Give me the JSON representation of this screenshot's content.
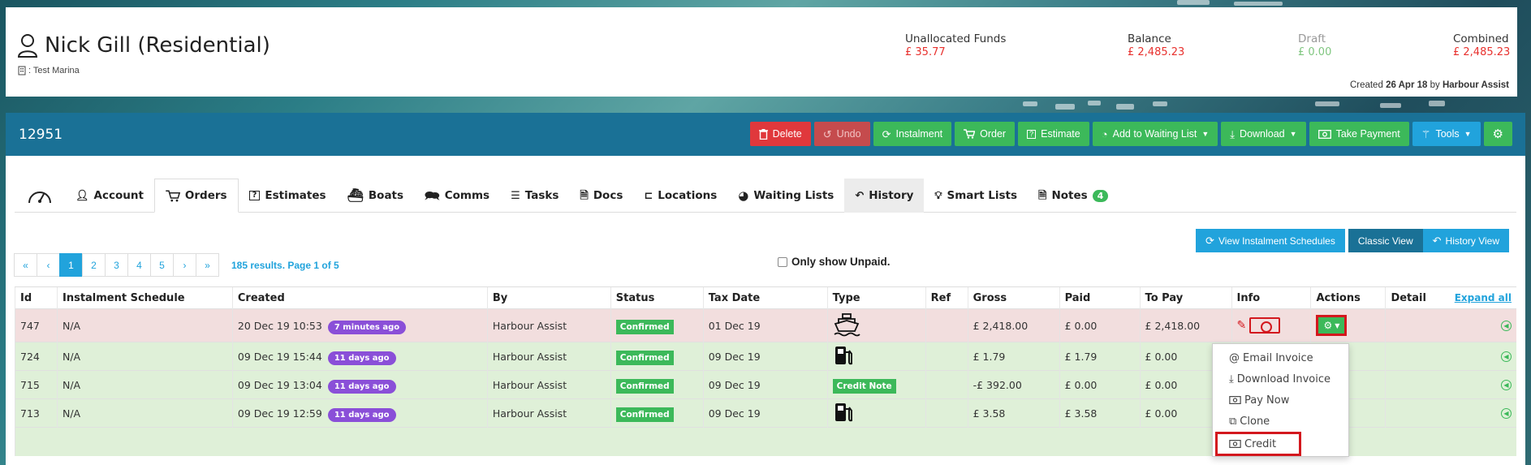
{
  "header": {
    "name": "Nick Gill (Residential)",
    "site_label": ": Test Marina",
    "stats": [
      {
        "label": "Unallocated Funds",
        "value": "£ 35.77",
        "tone": "red"
      },
      {
        "label": "Balance",
        "value": "£ 2,485.23",
        "tone": "red"
      },
      {
        "label": "Draft",
        "value": "£ 0.00",
        "tone": "green"
      },
      {
        "label": "Combined",
        "value": "£ 2,485.23",
        "tone": "red"
      }
    ],
    "created_prefix": "Created",
    "created_date": "26 Apr 18",
    "created_by_word": "by",
    "created_by": "Harbour Assist"
  },
  "panel": {
    "id": "12951",
    "toolbar": {
      "delete": "Delete",
      "undo": "Undo",
      "instalment": "Instalment",
      "order": "Order",
      "estimate": "Estimate",
      "waiting_list": "Add to Waiting List",
      "download": "Download",
      "take_payment": "Take Payment",
      "tools": "Tools"
    }
  },
  "tabs": [
    {
      "label": "Account"
    },
    {
      "label": "Orders"
    },
    {
      "label": "Estimates"
    },
    {
      "label": "Boats"
    },
    {
      "label": "Comms"
    },
    {
      "label": "Tasks"
    },
    {
      "label": "Docs"
    },
    {
      "label": "Locations"
    },
    {
      "label": "Waiting Lists"
    },
    {
      "label": "History"
    },
    {
      "label": "Smart Lists"
    },
    {
      "label": "Notes",
      "badge": "4"
    }
  ],
  "views": {
    "instalment_schedules": "View Instalment Schedules",
    "classic": "Classic View",
    "history": "History View"
  },
  "pager": {
    "first": "«",
    "prev": "‹",
    "pages": [
      "1",
      "2",
      "3",
      "4",
      "5"
    ],
    "next": "›",
    "last": "»",
    "results": "185 results. Page 1 of 5"
  },
  "filter": {
    "only_unpaid": "Only show Unpaid."
  },
  "table": {
    "headers": {
      "id": "Id",
      "schedule": "Instalment Schedule",
      "created": "Created",
      "by": "By",
      "status": "Status",
      "tax_date": "Tax Date",
      "type": "Type",
      "ref": "Ref",
      "gross": "Gross",
      "paid": "Paid",
      "to_pay": "To Pay",
      "info": "Info",
      "actions": "Actions",
      "detail": "Detail",
      "expand_all": "Expand all"
    },
    "rows": [
      {
        "id": "747",
        "schedule": "N/A",
        "created": "20 Dec 19 10:53",
        "ago": "7 minutes ago",
        "by": "Harbour Assist",
        "status": "Confirmed",
        "tax_date": "01 Dec 19",
        "type": "boat",
        "gross": "£ 2,418.00",
        "paid": "£ 0.00",
        "to_pay": "£ 2,418.00"
      },
      {
        "id": "724",
        "schedule": "N/A",
        "created": "09 Dec 19 15:44",
        "ago": "11 days ago",
        "by": "Harbour Assist",
        "status": "Confirmed",
        "tax_date": "09 Dec 19",
        "type": "fuel",
        "gross": "£ 1.79",
        "paid": "£ 1.79",
        "to_pay": "£ 0.00"
      },
      {
        "id": "715",
        "schedule": "N/A",
        "created": "09 Dec 19 13:04",
        "ago": "11 days ago",
        "by": "Harbour Assist",
        "status": "Confirmed",
        "tax_date": "09 Dec 19",
        "type_label": "Credit Note",
        "gross": "-£ 392.00",
        "paid": "£ 0.00",
        "to_pay": "£ 0.00"
      },
      {
        "id": "713",
        "schedule": "N/A",
        "created": "09 Dec 19 12:59",
        "ago": "11 days ago",
        "by": "Harbour Assist",
        "status": "Confirmed",
        "tax_date": "09 Dec 19",
        "type": "fuel",
        "gross": "£ 3.58",
        "paid": "£ 3.58",
        "to_pay": "£ 0.00"
      }
    ]
  },
  "dropdown": {
    "items": [
      "Email Invoice",
      "Download Invoice",
      "Pay Now",
      "Clone",
      "Credit"
    ]
  }
}
